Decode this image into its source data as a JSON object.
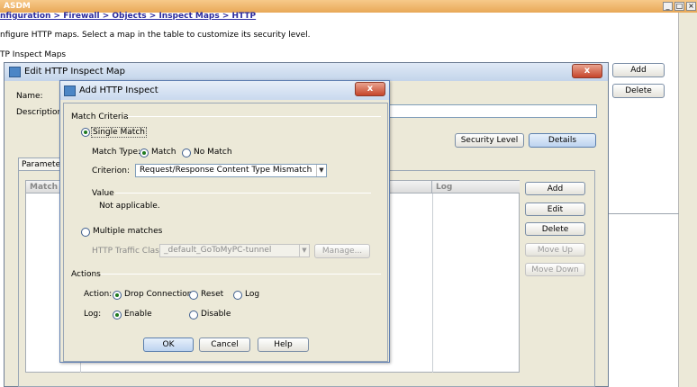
{
  "app": {
    "title": "ASDM",
    "breadcrumb": "nfiguration > Firewall > Objects > Inspect Maps > HTTP",
    "instruction": "nfigure HTTP maps. Select a map in the table to customize its security level.",
    "maps_label": "TP Inspect Maps",
    "add_label": "Add",
    "delete_label": "Delete"
  },
  "edit_window": {
    "title": "Edit HTTP Inspect Map",
    "name_label": "Name:",
    "description_label": "Description:",
    "security_level_label": "Security Level",
    "details_label": "Details",
    "tab_label": "Parameter",
    "match_column": "Match",
    "log_column": "Log",
    "buttons": {
      "add": "Add",
      "edit": "Edit",
      "delete": "Delete",
      "move_up": "Move Up",
      "move_down": "Move Down"
    },
    "close_glyph": "x"
  },
  "add_dialog": {
    "title": "Add HTTP Inspect",
    "close_glyph": "x",
    "match_criteria_label": "Match Criteria",
    "single_match_label": "Single Match",
    "match_type_label": "Match Type:",
    "match_label": "Match",
    "no_match_label": "No Match",
    "criterion_label": "Criterion:",
    "criterion_value": "Request/Response Content Type Mismatch",
    "value_label": "Value",
    "value_text": "Not applicable.",
    "multiple_matches_label": "Multiple matches",
    "traffic_class_label": "HTTP Traffic Class:",
    "traffic_class_value": "_default_GoToMyPC-tunnel",
    "manage_label": "Manage...",
    "actions_label": "Actions",
    "action_label": "Action:",
    "drop_connection_label": "Drop Connection",
    "reset_label": "Reset",
    "log_option_label": "Log",
    "log_label": "Log:",
    "enable_label": "Enable",
    "disable_label": "Disable",
    "ok_label": "OK",
    "cancel_label": "Cancel",
    "help_label": "Help"
  }
}
